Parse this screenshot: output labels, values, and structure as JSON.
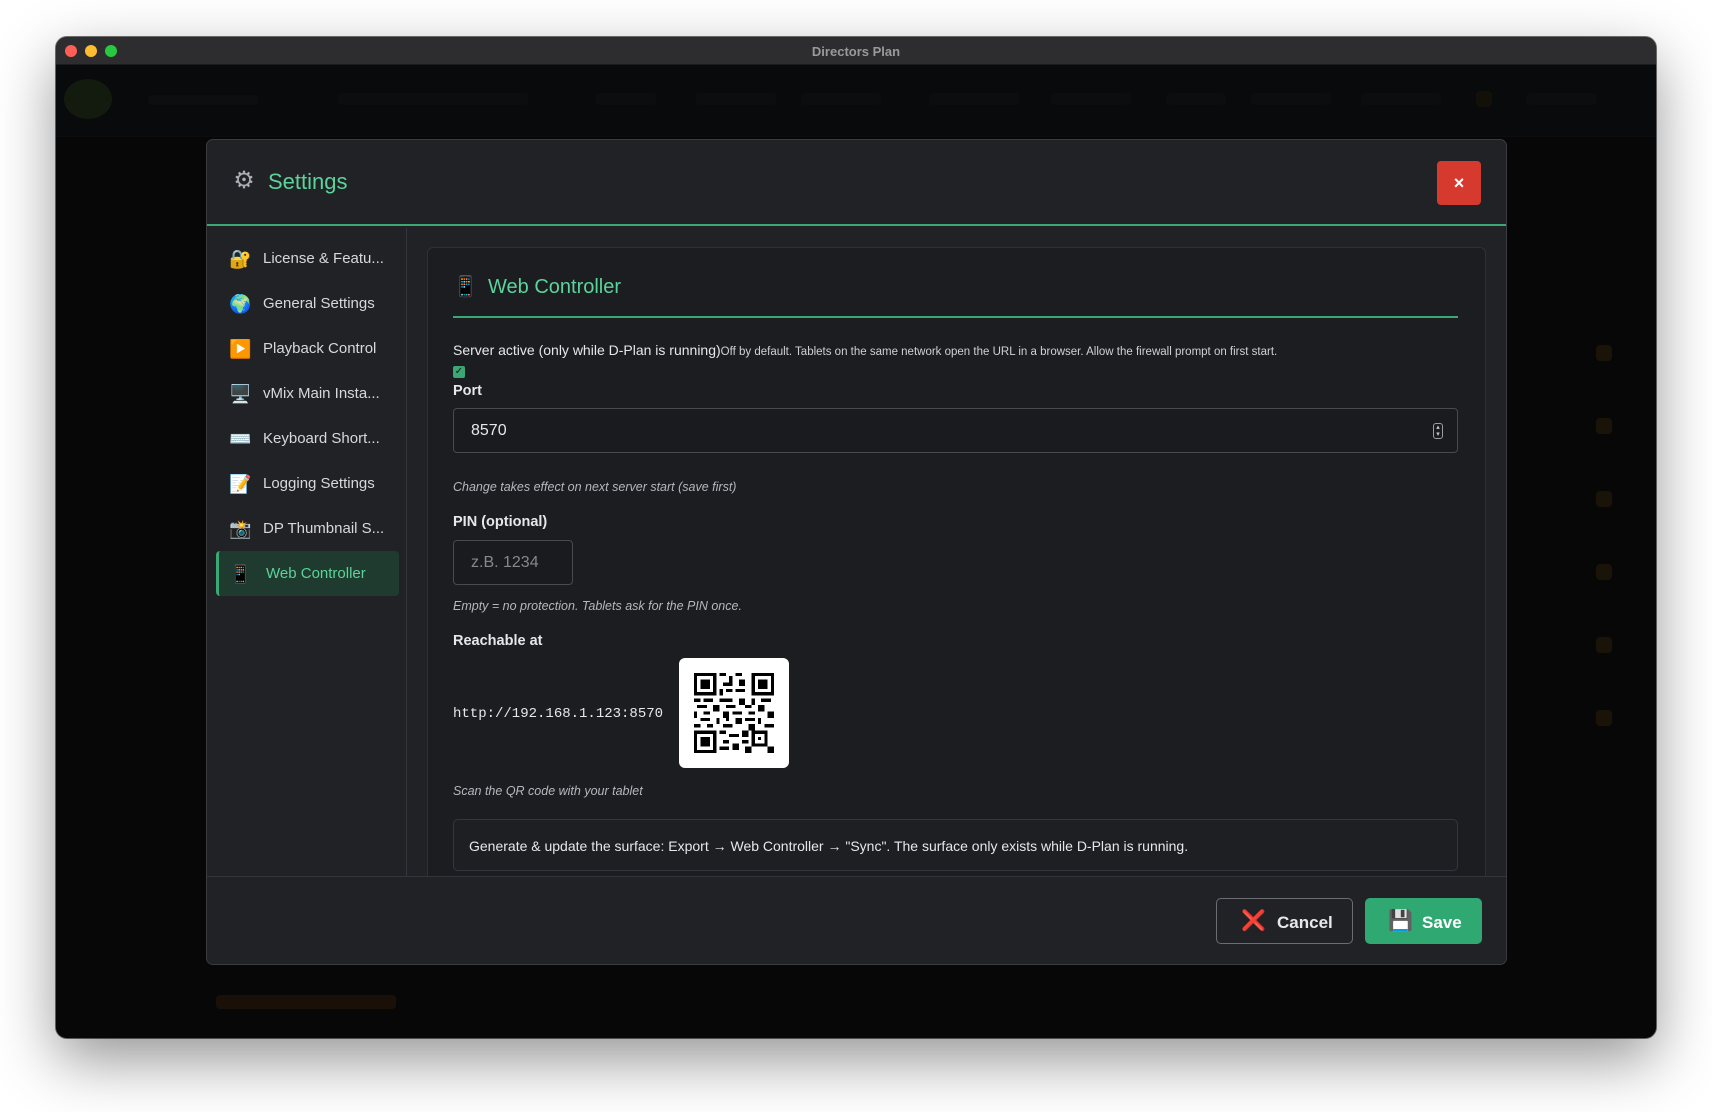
{
  "window": {
    "title": "Directors Plan"
  },
  "modal": {
    "title": "Settings",
    "close_label": "×",
    "gear_icon": "⚙",
    "sidebar": {
      "items": [
        {
          "label": "License & Featu...",
          "icon": "🔐"
        },
        {
          "label": "General Settings",
          "icon": "🌍"
        },
        {
          "label": "Playback Control",
          "icon": "▶️"
        },
        {
          "label": "vMix Main Insta...",
          "icon": "🖥️"
        },
        {
          "label": "Keyboard Short...",
          "icon": "⌨️"
        },
        {
          "label": "Logging Settings",
          "icon": "📝"
        },
        {
          "label": "DP Thumbnail S...",
          "icon": "📸"
        },
        {
          "label": "Web Controller",
          "icon": "📱",
          "active": true
        }
      ]
    },
    "panel": {
      "title": "Web Controller",
      "icon": "📱",
      "server_label": "Server active (only while D-Plan is running)",
      "server_hint": "Off by default. Tablets on the same network open the URL in a browser. Allow the firewall prompt on first start.",
      "server_checked": true,
      "port_label": "Port",
      "port_value": "8570",
      "port_hint": "Change takes effect on next server start (save first)",
      "pin_label": "PIN (optional)",
      "pin_placeholder": "z.B. 1234",
      "pin_hint": "Empty = no protection. Tablets ask for the PIN once.",
      "reachable_label": "Reachable at",
      "url": "http://192.168.1.123:8570",
      "qr_hint": "Scan the QR code with your tablet",
      "notice": "Generate & update the surface: Export → Web Controller → \"Sync\". The surface only exists while D-Plan is running."
    },
    "footer": {
      "cancel_label": "Cancel",
      "cancel_icon": "❌",
      "save_label": "Save",
      "save_icon": "💾"
    }
  },
  "colors": {
    "accent": "#5bd39a",
    "accent_line": "#3aa774",
    "danger": "#d63a2f",
    "save": "#2fa872"
  }
}
